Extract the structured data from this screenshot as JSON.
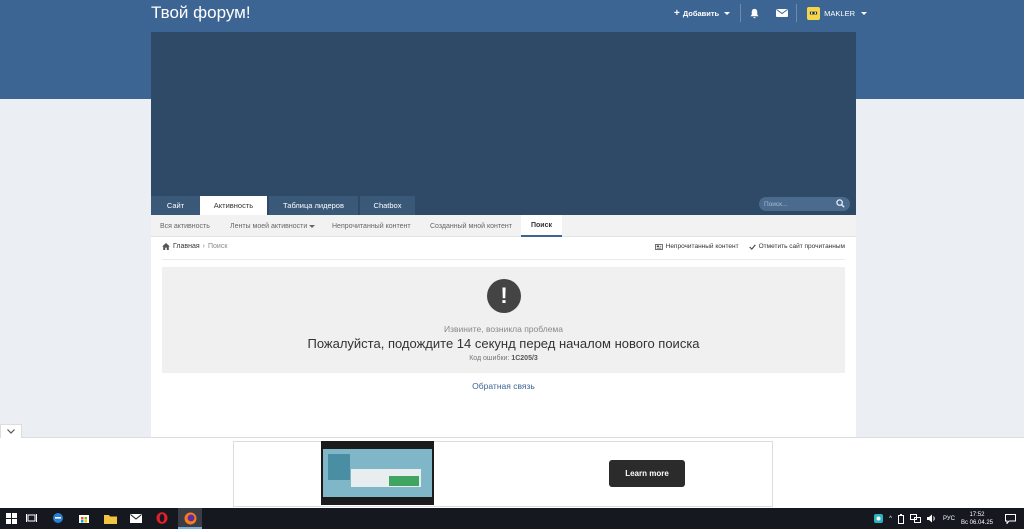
{
  "header": {
    "site_title": "Твой форум!",
    "add_label": "Добавить",
    "username": "MAKLER"
  },
  "tabs": [
    {
      "label": "Сайт",
      "active": false
    },
    {
      "label": "Активность",
      "active": true
    },
    {
      "label": "Таблица лидеров",
      "active": false
    },
    {
      "label": "Chatbox",
      "active": false
    }
  ],
  "search": {
    "placeholder": "Поиск..."
  },
  "subnav": [
    {
      "label": "Вся активность"
    },
    {
      "label": "Ленты моей активности"
    },
    {
      "label": "Непрочитанный контент"
    },
    {
      "label": "Созданный мной контент"
    },
    {
      "label": "Поиск"
    }
  ],
  "breadcrumb": {
    "home": "Главная",
    "current": "Поиск"
  },
  "actions": {
    "unread": "Непрочитанный контент",
    "mark_read": "Отметить сайт прочитанным"
  },
  "error": {
    "subtitle": "Извините, возникла проблема",
    "message": "Пожалуйста, подождите 14 секунд перед началом нового поиска",
    "code_label": "Код ошибки:",
    "code": "1C205/3"
  },
  "feedback": "Обратная связь",
  "ad": {
    "cta": "Learn more"
  },
  "taskbar": {
    "lang": "РУС",
    "time": "17:52",
    "date": "Вс 06.04.25"
  },
  "colors": {
    "brand": "#3d6594",
    "banner": "#2e4a66"
  }
}
